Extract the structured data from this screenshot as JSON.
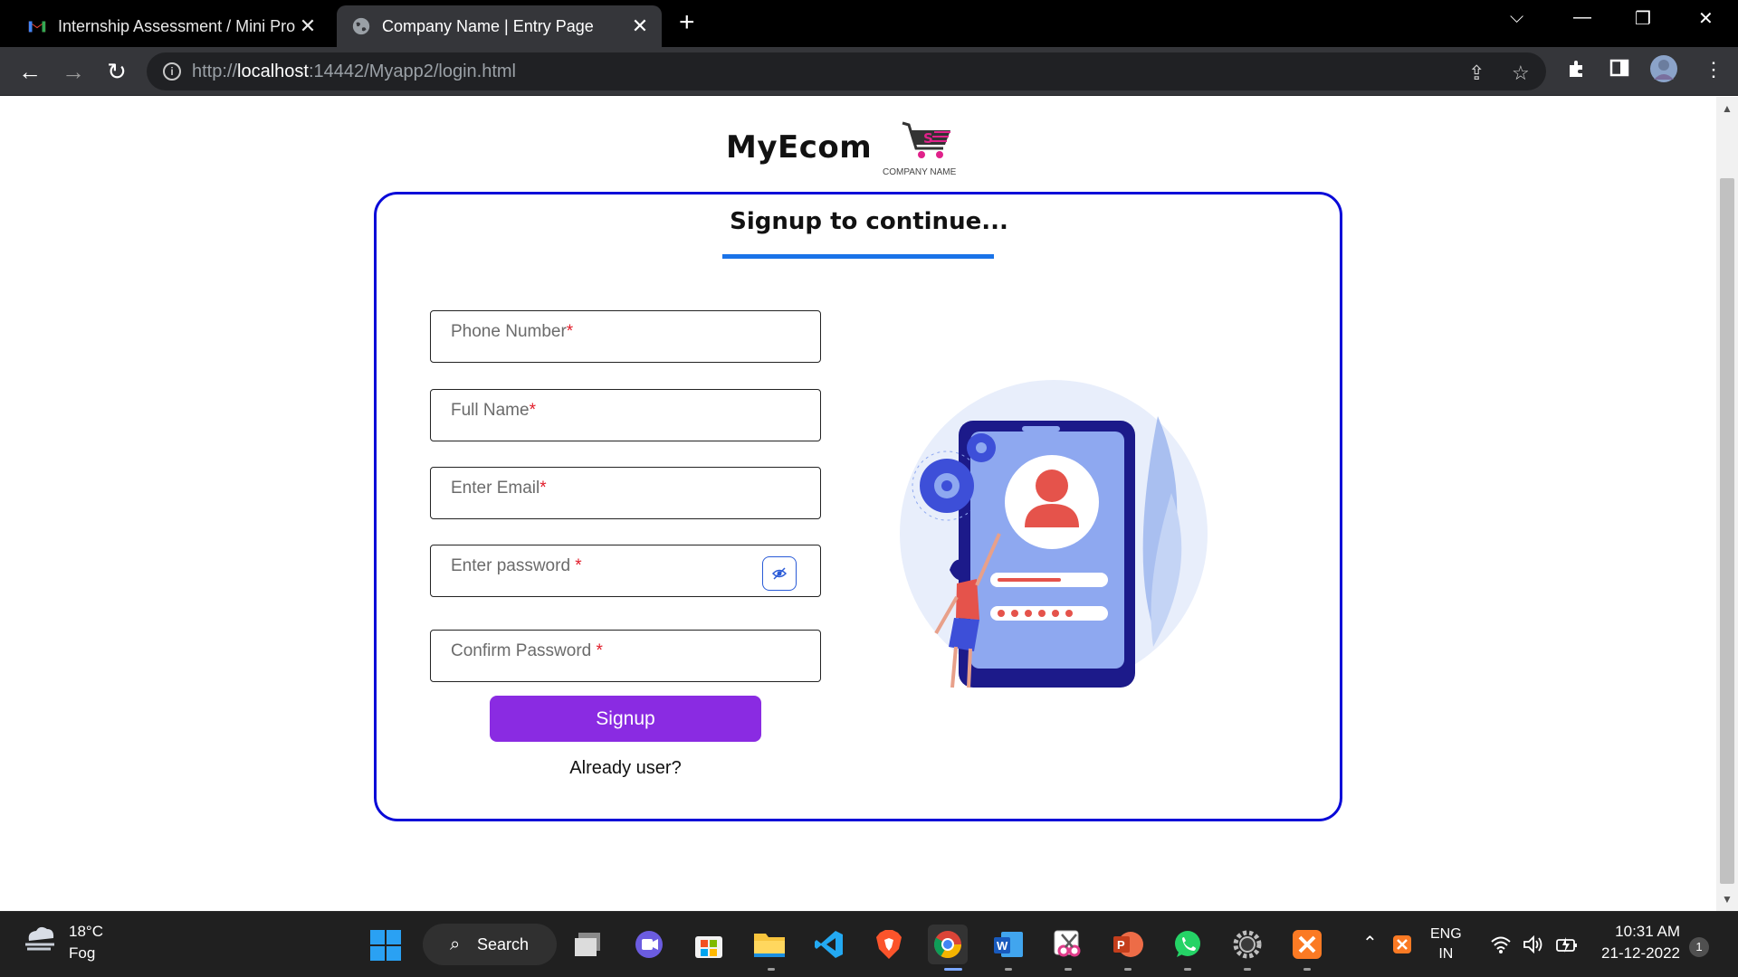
{
  "browser": {
    "tabs": [
      {
        "title": "Internship Assessment / Mini Pro",
        "close": "✕"
      },
      {
        "title": "Company Name | Entry Page",
        "close": "✕"
      }
    ],
    "new_tab": "+",
    "url_prefix": "http://",
    "url_host": "localhost",
    "url_rest": ":14442/Myapp2/login.html"
  },
  "page": {
    "brand": "MyEcom",
    "logo_caption": "COMPANY NAME",
    "title": "Signup to continue...",
    "fields": [
      {
        "placeholder": "Phone Number",
        "required": "*"
      },
      {
        "placeholder": "Full Name",
        "required": "*"
      },
      {
        "placeholder": "Enter Email",
        "required": "*"
      },
      {
        "placeholder": "Enter password ",
        "required": "*"
      },
      {
        "placeholder": "Confirm Password ",
        "required": "*"
      }
    ],
    "signup_label": "Signup",
    "already_user": "Already user?",
    "accent_color": "#8a2be2",
    "border_color": "#0a0ad8"
  },
  "taskbar": {
    "weather_temp": "18°C",
    "weather_cond": "Fog",
    "search_label": "Search",
    "lang_top": "ENG",
    "lang_bottom": "IN",
    "time": "10:31 AM",
    "date": "21-12-2022",
    "notifications": "1",
    "apps": [
      "start-icon",
      "task-view-icon",
      "teams-icon",
      "store-icon",
      "explorer-icon",
      "vscode-icon",
      "brave-icon",
      "chrome-icon",
      "word-icon",
      "snipping-icon",
      "powerpoint-icon",
      "whatsapp-icon",
      "settings-icon",
      "xampp-icon"
    ]
  }
}
